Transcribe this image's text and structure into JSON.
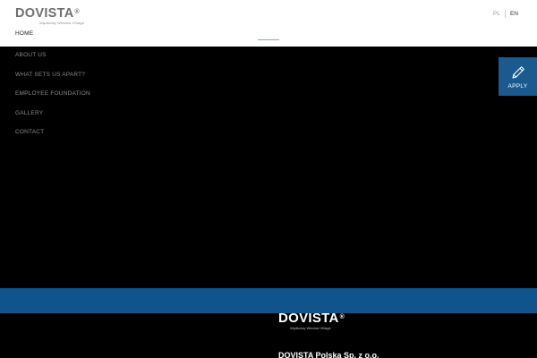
{
  "brand": {
    "name": "DOVISTA",
    "registered": "®",
    "tagline": "Wędkowy Window Village"
  },
  "languages": [
    {
      "code": "PL",
      "active": false
    },
    {
      "code": "EN",
      "active": true
    }
  ],
  "nav": {
    "home": "HOME",
    "items": [
      {
        "label": "ABOUT US"
      },
      {
        "label": "WHAT SETS US APART?"
      },
      {
        "label": "EMPLOYEE FOUNDATION"
      },
      {
        "label": "GALLERY"
      },
      {
        "label": "CONTACT"
      }
    ]
  },
  "apply": {
    "label": "APPLY",
    "icon": "pencil-icon"
  },
  "footer": {
    "brand_name": "DOVISTA",
    "registered": "®",
    "tagline": "Wędkowy Window Village",
    "company": "DOVISTA Polska Sp. z o.o."
  },
  "colors": {
    "accent": "#0f558b",
    "apply_bg": "#1b5a8e",
    "header_bg": "#ffffff",
    "page_bg": "#000000"
  }
}
